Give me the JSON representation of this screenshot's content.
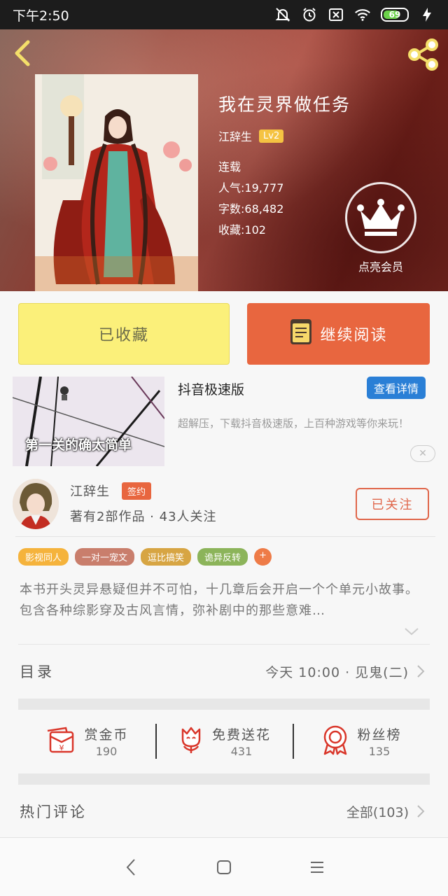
{
  "status_bar": {
    "time": "下午2:50",
    "battery": "69"
  },
  "book": {
    "title": "我在灵界做任务",
    "author": "江辞生",
    "level": "Lv2",
    "status": "连载",
    "popularity": "人气:19,777",
    "word_count": "字数:68,482",
    "favorites": "收藏:102",
    "vip_label": "点亮会员"
  },
  "actions": {
    "favorited_label": "已收藏",
    "continue_label": "继续阅读"
  },
  "ad": {
    "thumb_text": "第一关的确太简单",
    "title": "抖音极速版",
    "detail_label": "查看详情",
    "description": "超解压，下载抖音极速版，上百种游戏等你来玩！",
    "close_symbol": "✕"
  },
  "author_card": {
    "name": "江辞生",
    "badge": "签约",
    "stats": "著有2部作品 · 43人关注",
    "follow_label": "已关注"
  },
  "tags": [
    {
      "label": "影视同人",
      "color": "#f5b33c"
    },
    {
      "label": "一对一宠文",
      "color": "#c97e6c"
    },
    {
      "label": "逗比搞笑",
      "color": "#d7a543"
    },
    {
      "label": "诡异反转",
      "color": "#8cb45a"
    },
    {
      "label": "+",
      "color": "#ee7b47"
    }
  ],
  "description": "本书开头灵异悬疑但并不可怕，十几章后会开启一个个单元小故事。包含各种综影穿及古风言情，弥补剧中的那些意难…",
  "catalog": {
    "label": "目录",
    "latest": "今天 10:00 · 见鬼(二)"
  },
  "stats": [
    {
      "label": "赏金币",
      "value": "190",
      "icon": "reward-coin-icon"
    },
    {
      "label": "免费送花",
      "value": "431",
      "icon": "flower-icon"
    },
    {
      "label": "粉丝榜",
      "value": "135",
      "icon": "medal-icon"
    }
  ],
  "comments": {
    "label": "热门评论",
    "all": "全部(103)"
  },
  "colors": {
    "accent": "#e8663f",
    "favorite_bg": "#fbf07a",
    "detail_blue": "#2a7fd6"
  }
}
